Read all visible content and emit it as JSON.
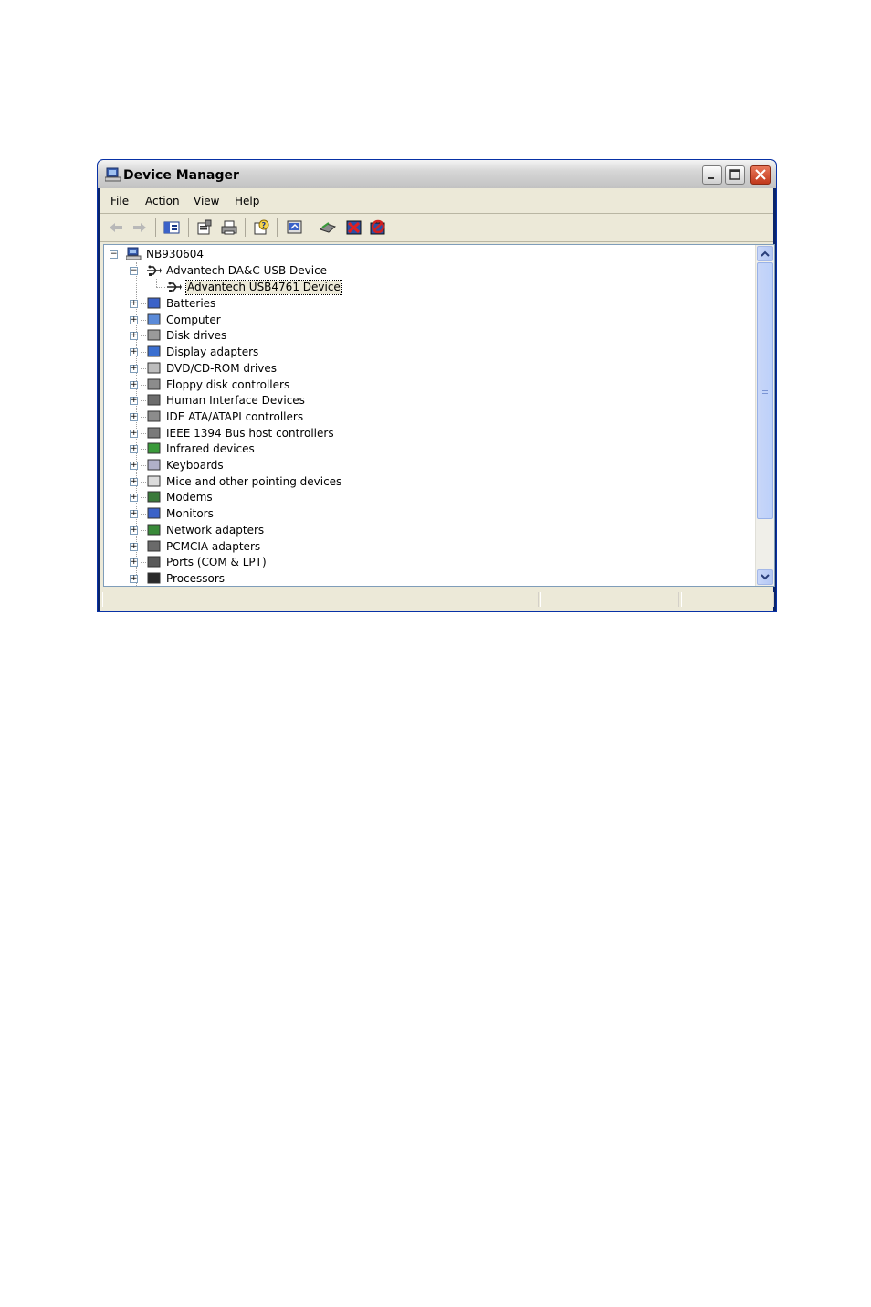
{
  "window": {
    "title": "Device Manager",
    "controls": {
      "minimize": "minimize-icon",
      "maximize": "maximize-icon",
      "close": "close-icon"
    }
  },
  "menu": [
    {
      "label": "File"
    },
    {
      "label": "Action"
    },
    {
      "label": "View"
    },
    {
      "label": "Help"
    }
  ],
  "toolbar": {
    "buttons": [
      "back-arrow-icon",
      "forward-arrow-icon",
      "show-hide-tree-icon",
      "properties-icon",
      "print-icon",
      "help-icon",
      "update-driver-icon",
      "scan-hardware-icon",
      "uninstall-icon",
      "disable-icon"
    ]
  },
  "tree": {
    "root": "NB930604",
    "expanded_group": "Advantech DA&C USB Device",
    "selected_child": "Advantech USB4761 Device",
    "categories": [
      "Batteries",
      "Computer",
      "Disk drives",
      "Display adapters",
      "DVD/CD-ROM drives",
      "Floppy disk controllers",
      "Human Interface Devices",
      "IDE ATA/ATAPI controllers",
      "IEEE 1394 Bus host controllers",
      "Infrared devices",
      "Keyboards",
      "Mice and other pointing devices",
      "Modems",
      "Monitors",
      "Network adapters",
      "PCMCIA adapters",
      "Ports (COM & LPT)",
      "Processors"
    ]
  },
  "colors": {
    "title_bar": "#d6d6d6",
    "selection": "#ece9d8",
    "close_button": "#c1381c",
    "scroll": "#c8d6f8"
  }
}
